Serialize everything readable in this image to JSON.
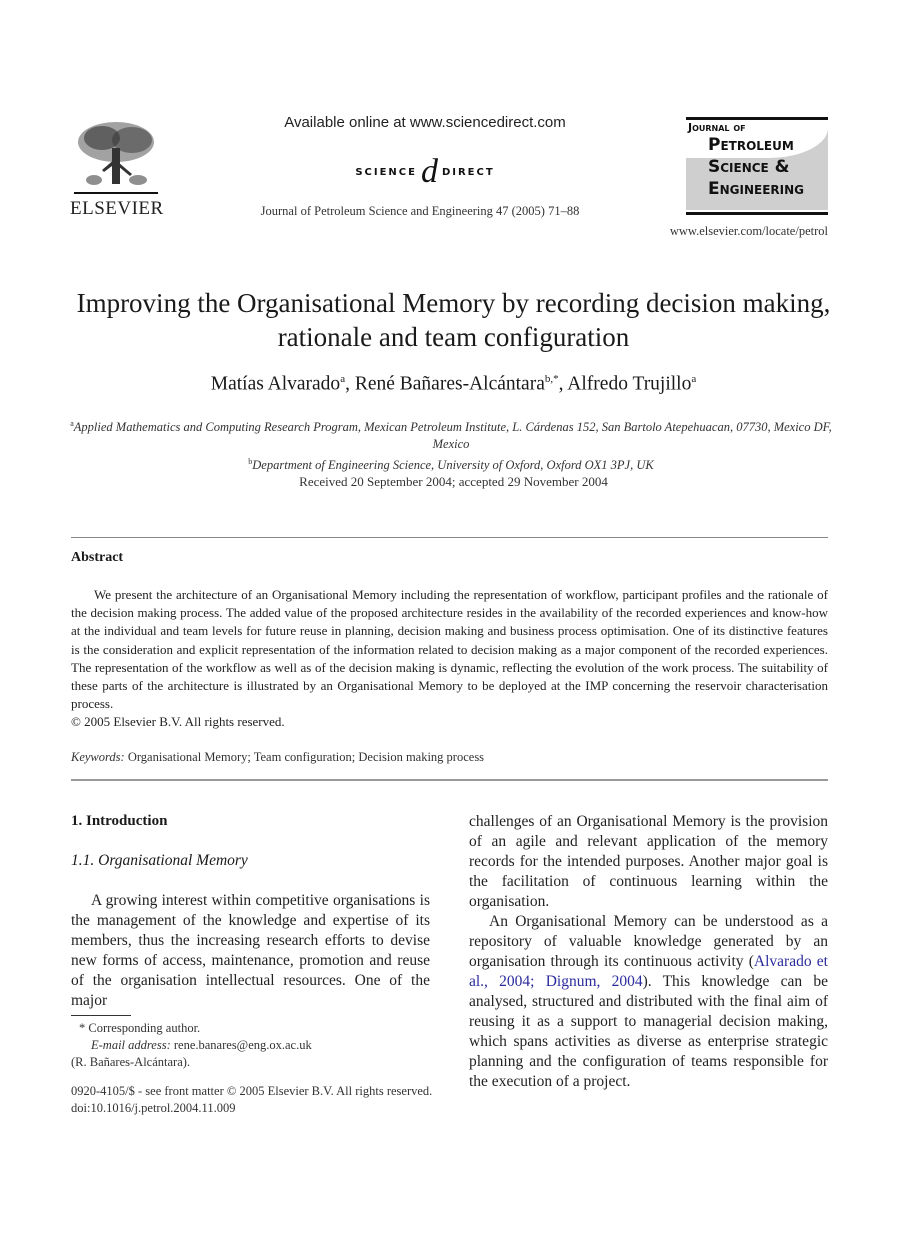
{
  "header": {
    "publisher_name": "ELSEVIER",
    "available_online": "Available online at www.sciencedirect.com",
    "sciencedirect_left": "SCIENCE",
    "sciencedirect_at": "d",
    "sciencedirect_right": "DIRECT",
    "journal_citation": "Journal of Petroleum Science and Engineering 47 (2005) 71–88",
    "journal_logo": {
      "line1": "Journal of",
      "line2": "Petroleum",
      "line3": "Science &",
      "line4": "Engineering"
    },
    "journal_url": "www.elsevier.com/locate/petrol"
  },
  "article": {
    "title": "Improving the Organisational Memory by recording decision making, rationale and team configuration",
    "authors": [
      {
        "name": "Matías Alvarado",
        "sup": "a"
      },
      {
        "name": "René Bañares-Alcántara",
        "sup": "b,*"
      },
      {
        "name": "Alfredo Trujillo",
        "sup": "a"
      }
    ],
    "separator": ", ",
    "affiliations": [
      {
        "sup": "a",
        "text": "Applied Mathematics and Computing Research Program, Mexican Petroleum Institute, L. Cárdenas 152, San Bartolo Atepehuacan, 07730, Mexico DF, Mexico"
      },
      {
        "sup": "b",
        "text": "Department of Engineering Science, University of Oxford, Oxford OX1 3PJ, UK"
      }
    ],
    "received": "Received 20 September 2004; accepted 29 November 2004"
  },
  "abstract": {
    "heading": "Abstract",
    "body": "We present the architecture of an Organisational Memory including the representation of workflow, participant profiles and the rationale of the decision making process. The added value of the proposed architecture resides in the availability of the recorded experiences and know-how at the individual and team levels for future reuse in planning, decision making and business process optimisation. One of its distinctive features is the consideration and explicit representation of the information related to decision making as a major component of the recorded experiences. The representation of the workflow as well as of the decision making is dynamic, reflecting the evolution of the work process. The suitability of these parts of the architecture is illustrated by an Organisational Memory to be deployed at the IMP concerning the reservoir characterisation process.",
    "copyright": "© 2005 Elsevier B.V. All rights reserved.",
    "keywords_label": "Keywords:",
    "keywords": "Organisational Memory; Team configuration; Decision making process"
  },
  "body": {
    "section_heading": "1. Introduction",
    "subsection_heading": "1.1. Organisational Memory",
    "left_paragraph": "A growing interest within competitive organisations is the management of the knowledge and expertise of its members, thus the increasing research efforts to devise new forms of access, maintenance, promotion and reuse of the organisation intellectual resources. One of the major",
    "right_paragraph1": "challenges of an Organisational Memory is the provision of an agile and relevant application of the memory records for the intended purposes. Another major goal is the facilitation of continuous learning within the organisation.",
    "right_paragraph2_before": "An Organisational Memory can be understood as a repository of valuable knowledge generated by an organisation through its continuous activity (",
    "right_paragraph2_cite": "Alvarado et al., 2004; Dignum, 2004",
    "right_paragraph2_after": "). This knowledge can be analysed, structured and distributed with the final aim of reusing it as a support to managerial decision making, which spans activities as diverse as enterprise strategic planning and the configuration of teams responsible for the execution of a project."
  },
  "footnotes": {
    "corresponding": "* Corresponding author.",
    "email_label": "E-mail address:",
    "email": "rene.banares@eng.ox.ac.uk",
    "email_name": "(R. Bañares-Alcántara).",
    "issn": "0920-4105/$ - see front matter © 2005 Elsevier B.V. All rights reserved.",
    "doi": "doi:10.1016/j.petrol.2004.11.009"
  },
  "colors": {
    "citation_link": "#2b2b9e",
    "text": "#1a1a1a"
  }
}
